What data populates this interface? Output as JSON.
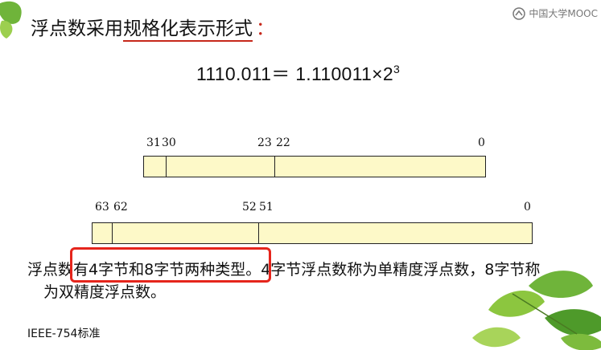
{
  "slide": {
    "title_part1": "浮点数采用",
    "title_highlight": "规格化表示形式",
    "title_colon": "：",
    "formula_lhs": "1110.011＝ 1.110011×2",
    "formula_exp": "3",
    "register32": {
      "labels": [
        "31",
        "30",
        "23",
        "22",
        "0"
      ]
    },
    "register64": {
      "labels": [
        "63",
        "62",
        "52",
        "51",
        "0"
      ]
    },
    "desc_line1_a": "浮点数有",
    "desc_line1_b": "4字节和8字节两种类型",
    "desc_line1_c": "。4字节浮点数称为单精度浮点数，8字节称",
    "desc_line2": "为双精度浮点数。",
    "footer": "IEEE-754标准",
    "watermark": "中国大学MOOC"
  },
  "colors": {
    "register_fill": "#fdf9c8",
    "highlight_red": "#e5251c",
    "leaf_green": "#8cc63f"
  }
}
